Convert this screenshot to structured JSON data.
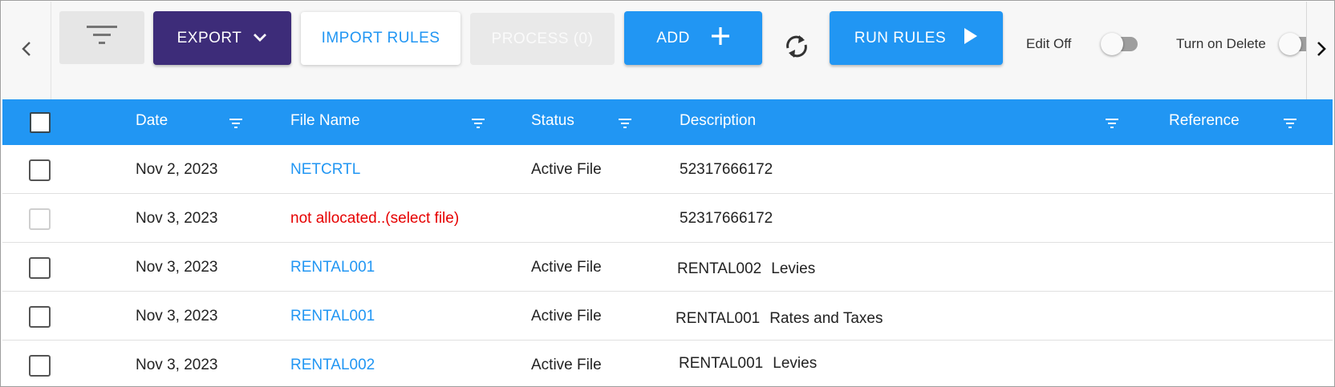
{
  "toolbar": {
    "export_label": "EXPORT",
    "import_label": "IMPORT RULES",
    "process_label": "PROCESS (0)",
    "add_label": "ADD",
    "run_label": "RUN RULES",
    "edit_toggle_label": "Edit Off",
    "delete_toggle_label": "Turn on Delete",
    "icons": {
      "nav_left": "chevron-left-icon",
      "filter": "filter-icon",
      "export": "chevron-down-icon",
      "add": "plus-icon",
      "refresh": "refresh-icon",
      "run": "play-icon",
      "nav_right": "chevron-right-icon"
    }
  },
  "table": {
    "headers": {
      "date": "Date",
      "file_name": "File Name",
      "status": "Status",
      "description": "Description",
      "reference": "Reference"
    },
    "rows": [
      {
        "date": "Nov 2, 2023",
        "file_name": "NETCRTL",
        "status": "Active File",
        "desc_a": "52317666172",
        "desc_b": "",
        "reference": "",
        "checkbox_enabled": true
      },
      {
        "date": "Nov 3, 2023",
        "file_name": "not allocated..(select file)",
        "status": "",
        "desc_a": "52317666172",
        "desc_b": "",
        "reference": "",
        "checkbox_enabled": false
      },
      {
        "date": "Nov 3, 2023",
        "file_name": "RENTAL001",
        "status": "Active File",
        "desc_a": "RENTAL002",
        "desc_b": "Levies",
        "reference": "",
        "checkbox_enabled": true
      },
      {
        "date": "Nov 3, 2023",
        "file_name": "RENTAL001",
        "status": "Active File",
        "desc_a": "RENTAL001",
        "desc_b": "Rates and Taxes",
        "reference": "",
        "checkbox_enabled": true
      },
      {
        "date": "Nov 3, 2023",
        "file_name": "RENTAL002",
        "status": "Active File",
        "desc_a": "RENTAL001",
        "desc_b": "Levies",
        "reference": "",
        "checkbox_enabled": true
      }
    ]
  },
  "colors": {
    "primary": "#2196f3",
    "export_bg": "#3d2c79",
    "warning_text": "#e60000",
    "toolbar_bg": "#f7f7f7"
  }
}
